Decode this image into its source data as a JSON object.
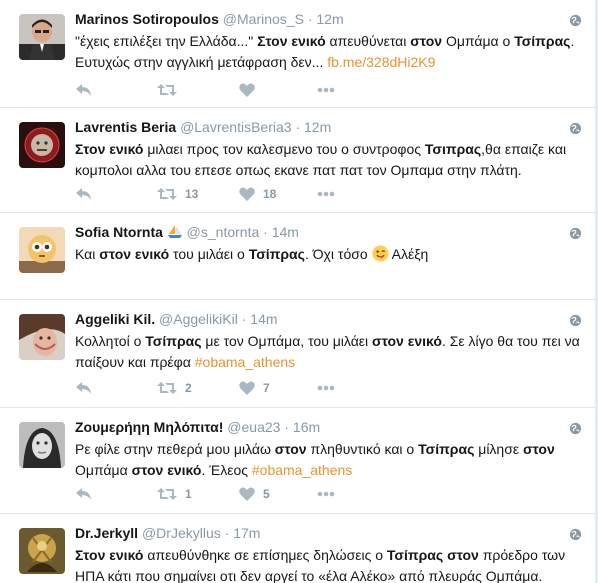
{
  "tweets": [
    {
      "name": "Marinos Sotiropoulos",
      "handle": "@Marinos_S",
      "time": "12m",
      "segments": [
        {
          "t": "\"έχεις επιλέξει την Ελλάδα...\" "
        },
        {
          "t": "Στον ενικό",
          "b": true
        },
        {
          "t": " απευθύνεται "
        },
        {
          "t": "στον",
          "b": true
        },
        {
          "t": " Ομπάμα ο "
        },
        {
          "t": "Τσίπρας",
          "b": true
        },
        {
          "t": ". Ευτυχώς στην αγγλική μετάφραση δεν... "
        },
        {
          "t": "fb.me/328dHi2K9",
          "link": true
        }
      ],
      "retweets": "",
      "likes": ""
    },
    {
      "name": "Lavrentis Beria",
      "handle": "@LavrentisBeria3",
      "time": "12m",
      "segments": [
        {
          "t": "Στον ενικό",
          "b": true
        },
        {
          "t": " μιλαει προς τον καλεσμενο του ο συντροφος "
        },
        {
          "t": "Τσιπρας",
          "b": true
        },
        {
          "t": ",θα επαιζε και κομπολοι αλλα του επεσε οπως εκανε πατ πατ τον Ομπαμα στην πλάτη."
        }
      ],
      "retweets": "13",
      "likes": "18"
    },
    {
      "name": "Sofia Ntornta",
      "handle": "@s_ntornta",
      "time": "14m",
      "segments": [
        {
          "t": "Και "
        },
        {
          "t": "στον ενικό",
          "b": true
        },
        {
          "t": " του μιλάει ο "
        },
        {
          "t": "Τσίπρας",
          "b": true
        },
        {
          "t": ". Όχι τόσο "
        },
        {
          "emoji": "winking-face-tongue"
        },
        {
          "t": " Αλέξη"
        }
      ],
      "retweets": "",
      "likes": ""
    },
    {
      "name": "Aggeliki Kil.",
      "handle": "@AggelikiKil",
      "time": "14m",
      "segments": [
        {
          "t": "Κολλητοί ο "
        },
        {
          "t": "Τσίπρας",
          "b": true
        },
        {
          "t": " με τον Ομπάμα, του μιλάει "
        },
        {
          "t": "στον ενικό",
          "b": true
        },
        {
          "t": ". Σε λίγο θα του πει να παίξουν και πρέφα "
        },
        {
          "t": "#obama_athens",
          "link": true
        }
      ],
      "retweets": "2",
      "likes": "7"
    },
    {
      "name": "Ζουμερήηη Μηλόπιτα!",
      "handle": "@eua23",
      "time": "16m",
      "segments": [
        {
          "t": "Ρε φίλε στην πεθερά μου μιλάω "
        },
        {
          "t": "στον",
          "b": true
        },
        {
          "t": " πληθυντικό και ο "
        },
        {
          "t": "Τσίπρας",
          "b": true
        },
        {
          "t": " μίλησε "
        },
        {
          "t": "στον",
          "b": true
        },
        {
          "t": " Ομπάμα "
        },
        {
          "t": "στον ενικό",
          "b": true
        },
        {
          "t": ". Έλεος  "
        },
        {
          "t": "#obama_athens",
          "link": true
        }
      ],
      "retweets": "1",
      "likes": "5"
    },
    {
      "name": "Dr.Jerkyll",
      "handle": "@DrJekyllus",
      "time": "17m",
      "segments": [
        {
          "t": "Στον ενικό",
          "b": true
        },
        {
          "t": " απευθύνθηκε σε επίσημες δηλώσεις ο "
        },
        {
          "t": "Τσίπρας",
          "b": true
        },
        {
          "t": " "
        },
        {
          "t": "στον",
          "b": true
        },
        {
          "t": " πρόεδρο των ΗΠΑ κάτι που σημαίνει οτι δεν αργεί το «έλα Αλέκο» από πλευράς Ομπάμα."
        }
      ],
      "retweets": "",
      "likes": ""
    }
  ],
  "icons": {
    "reply": "reply-icon",
    "retweet": "retweet-icon",
    "like": "heart-icon",
    "more": "more-icon",
    "globe": "globe-icon"
  },
  "colors": {
    "link": "#e8932e",
    "meta": "#8899a6",
    "action": "#aab8c2"
  }
}
